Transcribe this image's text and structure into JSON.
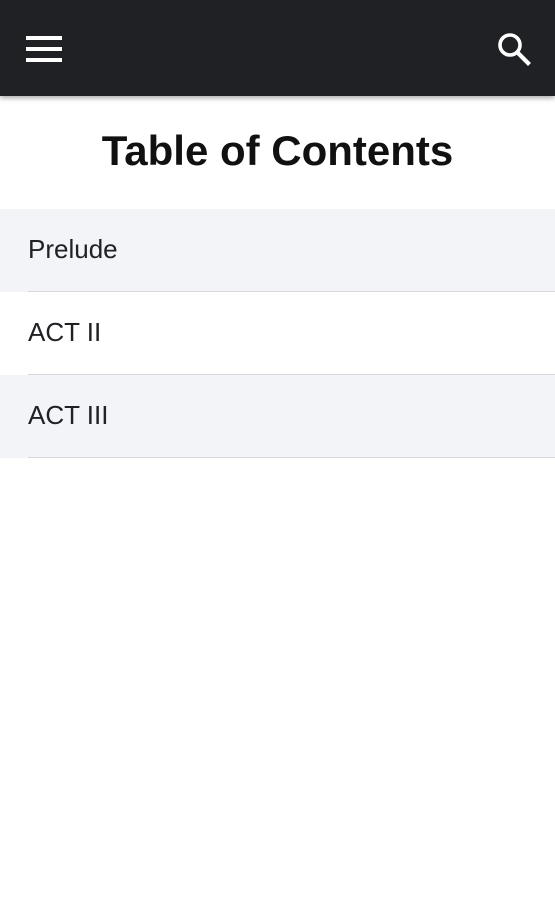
{
  "toolbar": {
    "menu_icon": "hamburger-menu-icon",
    "search_icon": "search-icon",
    "background": "#202124"
  },
  "page": {
    "title": "Table of Contents"
  },
  "toc": {
    "items": [
      {
        "label": "Prelude"
      },
      {
        "label": "ACT II"
      },
      {
        "label": "ACT III"
      }
    ]
  }
}
